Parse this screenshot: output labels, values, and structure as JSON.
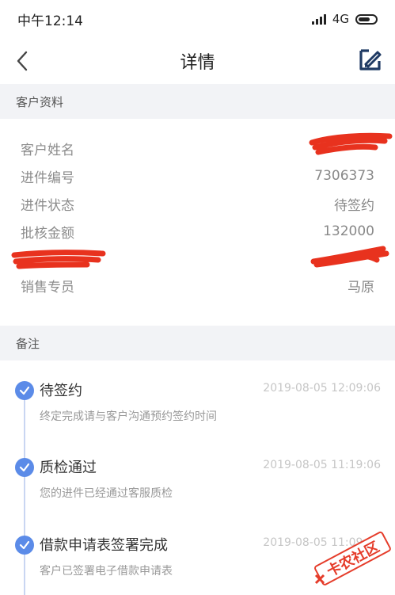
{
  "status_bar": {
    "time": "中午12:14",
    "network": "4G"
  },
  "nav": {
    "title": "详情",
    "back_icon": "chevron-left-icon",
    "edit_icon": "edit-icon"
  },
  "customer_section": {
    "header": "客户资料",
    "rows": [
      {
        "label": "客户姓名",
        "value": ""
      },
      {
        "label": "进件编号",
        "value": "7306373"
      },
      {
        "label": "进件状态",
        "value": "待签约"
      },
      {
        "label": "批核金额",
        "value": "132000"
      },
      {
        "label": "",
        "value": ""
      },
      {
        "label": "销售专员",
        "value": "马原"
      }
    ]
  },
  "notes_section": {
    "header": "备注",
    "timeline": [
      {
        "title": "待签约",
        "time": "2019-08-05 12:09:06",
        "desc": "终定完成请与客户沟通预约签约时间"
      },
      {
        "title": "质检通过",
        "time": "2019-08-05 11:19:06",
        "desc": "您的进件已经通过客服质检"
      },
      {
        "title": "借款申请表签署完成",
        "time": "2019-08-05 11:09:06",
        "desc": "客户已签署电子借款申请表"
      }
    ]
  },
  "watermark": {
    "text": "卡农社区"
  },
  "colors": {
    "accent": "#5b8be8",
    "section_bg": "#f2f3f6",
    "redaction": "#e8321e",
    "nav_icon": "#1f3a63"
  }
}
